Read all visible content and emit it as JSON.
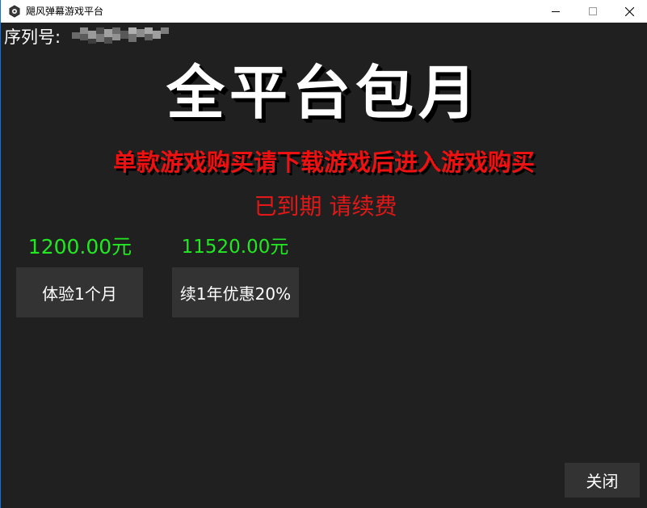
{
  "window": {
    "title": "飓风弹幕游戏平台",
    "icon": "hexagon-app-icon",
    "controls": [
      "minimize-icon",
      "maximize-icon",
      "close-icon"
    ]
  },
  "serial": {
    "label": "序列号:",
    "value_state": "pixelated / redacted"
  },
  "headline": "全平台包月",
  "notice": "单款游戏购买请下载游戏后进入游戏购买",
  "status": "已到期 请续费",
  "plans": [
    {
      "price": "1200.00元",
      "button_label": "体验1个月"
    },
    {
      "price": "11520.00元",
      "button_label": "续1年优惠20%"
    }
  ],
  "footer": {
    "close_label": "关闭"
  },
  "colors": {
    "background": "#202020",
    "titlebar": "#ffffff",
    "headline": "#ffffff",
    "notice": "#ee1111",
    "status": "#e01818",
    "price": "#22e822",
    "button_bg": "#333333",
    "button_text": "#ffffff"
  }
}
